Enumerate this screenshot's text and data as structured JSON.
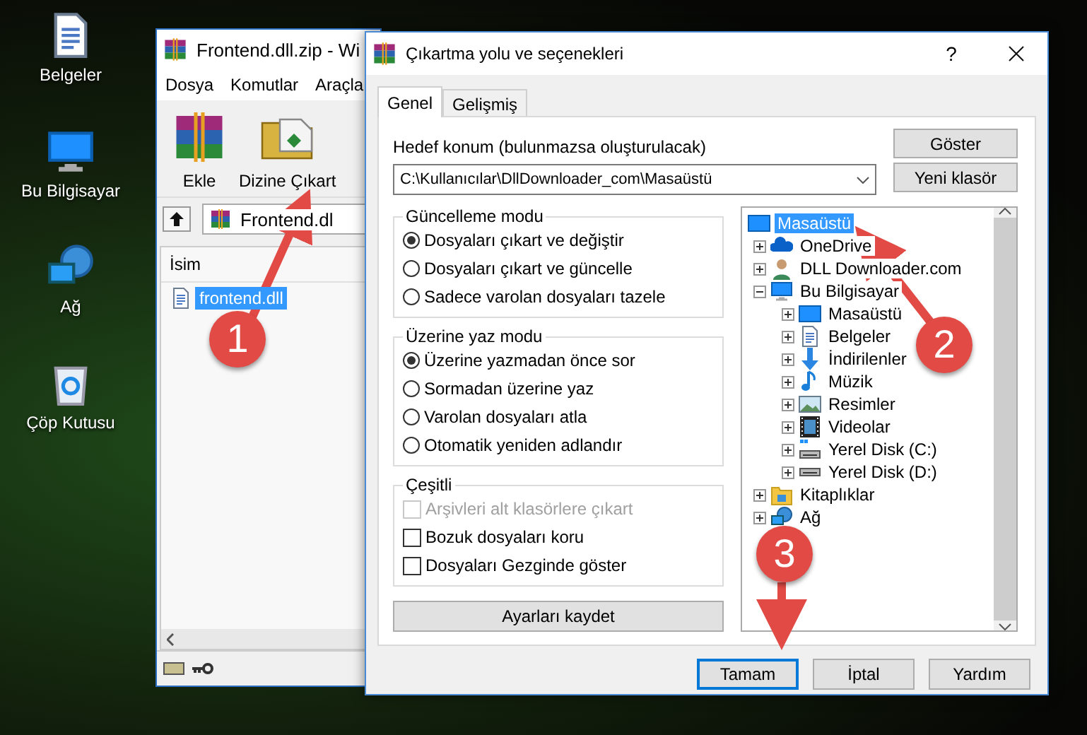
{
  "desktop_icons": [
    {
      "label": "Belgeler",
      "kind": "documents"
    },
    {
      "label": "Bu Bilgisayar",
      "kind": "computer"
    },
    {
      "label": "Ağ",
      "kind": "network"
    },
    {
      "label": "Çöp Kutusu",
      "kind": "recycle"
    }
  ],
  "archive_window": {
    "title": "Frontend.dll.zip - Wi",
    "menu": [
      "Dosya",
      "Komutlar",
      "Araçla"
    ],
    "toolbar": [
      {
        "label": "Ekle",
        "kind": "add"
      },
      {
        "label": "Dizine Çıkart",
        "kind": "extract"
      }
    ],
    "path": "Frontend.dl",
    "columns": [
      "İsim"
    ],
    "files": [
      {
        "name": "frontend.dll",
        "selected": true
      }
    ]
  },
  "dialog": {
    "title": "Çıkartma yolu ve seçenekleri",
    "help": "?",
    "tabs": [
      {
        "label": "Genel",
        "selected": true
      },
      {
        "label": "Gelişmiş",
        "selected": false
      }
    ],
    "destination": {
      "label": "Hedef konum (bulunmazsa oluşturulacak)",
      "value": "C:\\Kullanıcılar\\DllDownloader_com\\Masaüstü"
    },
    "side_buttons": [
      "Göster",
      "Yeni klasör"
    ],
    "groups": [
      {
        "title": "Güncelleme modu",
        "options": [
          {
            "label": "Dosyaları çıkart ve değiştir",
            "kind": "radio",
            "selected": true
          },
          {
            "label": "Dosyaları çıkart ve güncelle",
            "kind": "radio",
            "selected": false
          },
          {
            "label": "Sadece varolan dosyaları tazele",
            "kind": "radio",
            "selected": false
          }
        ]
      },
      {
        "title": "Üzerine yaz modu",
        "options": [
          {
            "label": "Üzerine yazmadan önce sor",
            "kind": "radio",
            "selected": true
          },
          {
            "label": "Sormadan üzerine yaz",
            "kind": "radio",
            "selected": false
          },
          {
            "label": "Varolan dosyaları atla",
            "kind": "radio",
            "selected": false
          },
          {
            "label": "Otomatik yeniden adlandır",
            "kind": "radio",
            "selected": false
          }
        ]
      },
      {
        "title": "Çeşitli",
        "options": [
          {
            "label": "Arşivleri alt klasörlere çıkart",
            "kind": "checkbox",
            "checked": false,
            "disabled": true
          },
          {
            "label": "Bozuk dosyaları koru",
            "kind": "checkbox",
            "checked": false,
            "disabled": false
          },
          {
            "label": "Dosyaları Gezginde göster",
            "kind": "checkbox",
            "checked": false,
            "disabled": false
          }
        ]
      }
    ],
    "save_button": "Ayarları kaydet",
    "tree": [
      {
        "label": "Masaüstü",
        "kind": "desktop",
        "selected": true,
        "children": [
          {
            "label": "OneDrive",
            "kind": "cloud",
            "selected": false,
            "expanded": false
          },
          {
            "label": "DLL Downloader.com",
            "kind": "user",
            "selected": false,
            "expanded": false
          },
          {
            "label": "Bu Bilgisayar",
            "kind": "computer",
            "selected": false,
            "expanded": true,
            "children": [
              {
                "label": "Masaüstü",
                "kind": "desktop",
                "selected": false,
                "expanded": false
              },
              {
                "label": "Belgeler",
                "kind": "documents",
                "selected": false,
                "expanded": false
              },
              {
                "label": "İndirilenler",
                "kind": "download",
                "selected": false,
                "expanded": false
              },
              {
                "label": "Müzik",
                "kind": "music",
                "selected": false,
                "expanded": false
              },
              {
                "label": "Resimler",
                "kind": "pictures",
                "selected": false,
                "expanded": false
              },
              {
                "label": "Videolar",
                "kind": "video",
                "selected": false,
                "expanded": false
              },
              {
                "label": "Yerel Disk (C:)",
                "kind": "systemdrive",
                "selected": false,
                "expanded": false
              },
              {
                "label": "Yerel Disk (D:)",
                "kind": "drive",
                "selected": false,
                "expanded": false
              }
            ]
          },
          {
            "label": "Kitaplıklar",
            "kind": "library",
            "selected": false,
            "expanded": false
          },
          {
            "label": "Ağ",
            "kind": "network",
            "selected": false,
            "expanded": false
          }
        ]
      }
    ],
    "buttons": [
      {
        "label": "Tamam",
        "default": true
      },
      {
        "label": "İptal",
        "default": false
      },
      {
        "label": "Yardım",
        "default": false
      }
    ]
  },
  "annotations": [
    {
      "label": "1"
    },
    {
      "label": "2"
    },
    {
      "label": "3"
    }
  ]
}
